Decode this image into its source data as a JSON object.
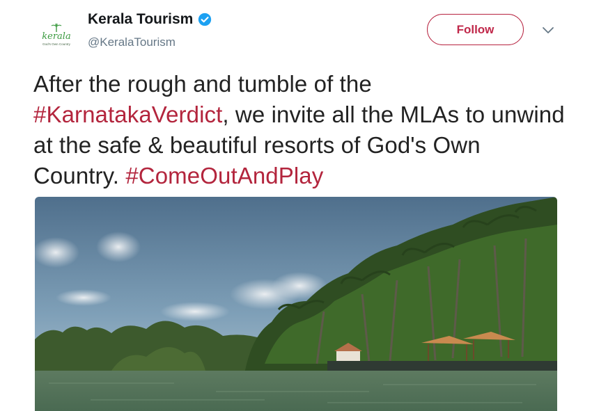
{
  "account": {
    "display_name": "Kerala Tourism",
    "handle": "@KeralaTourism",
    "verified": true,
    "logo_word": "kerala",
    "logo_tagline": "God's Own Country"
  },
  "actions": {
    "follow_label": "Follow",
    "menu_icon": "chevron-down-icon"
  },
  "tweet": {
    "text_1": "After the rough and tumble of the ",
    "hashtag_1": "#KarnatakaVerdict",
    "text_2": ", we invite all the MLAs to unwind at the safe & beautiful resorts of God's Own Country. ",
    "hashtag_2": "#ComeOutAndPlay"
  },
  "colors": {
    "hashtag": "#b3253d",
    "follow_border": "#b6223f",
    "verified": "#1da1f2"
  },
  "media": {
    "type": "photo",
    "icon": "photo-backwaters"
  }
}
